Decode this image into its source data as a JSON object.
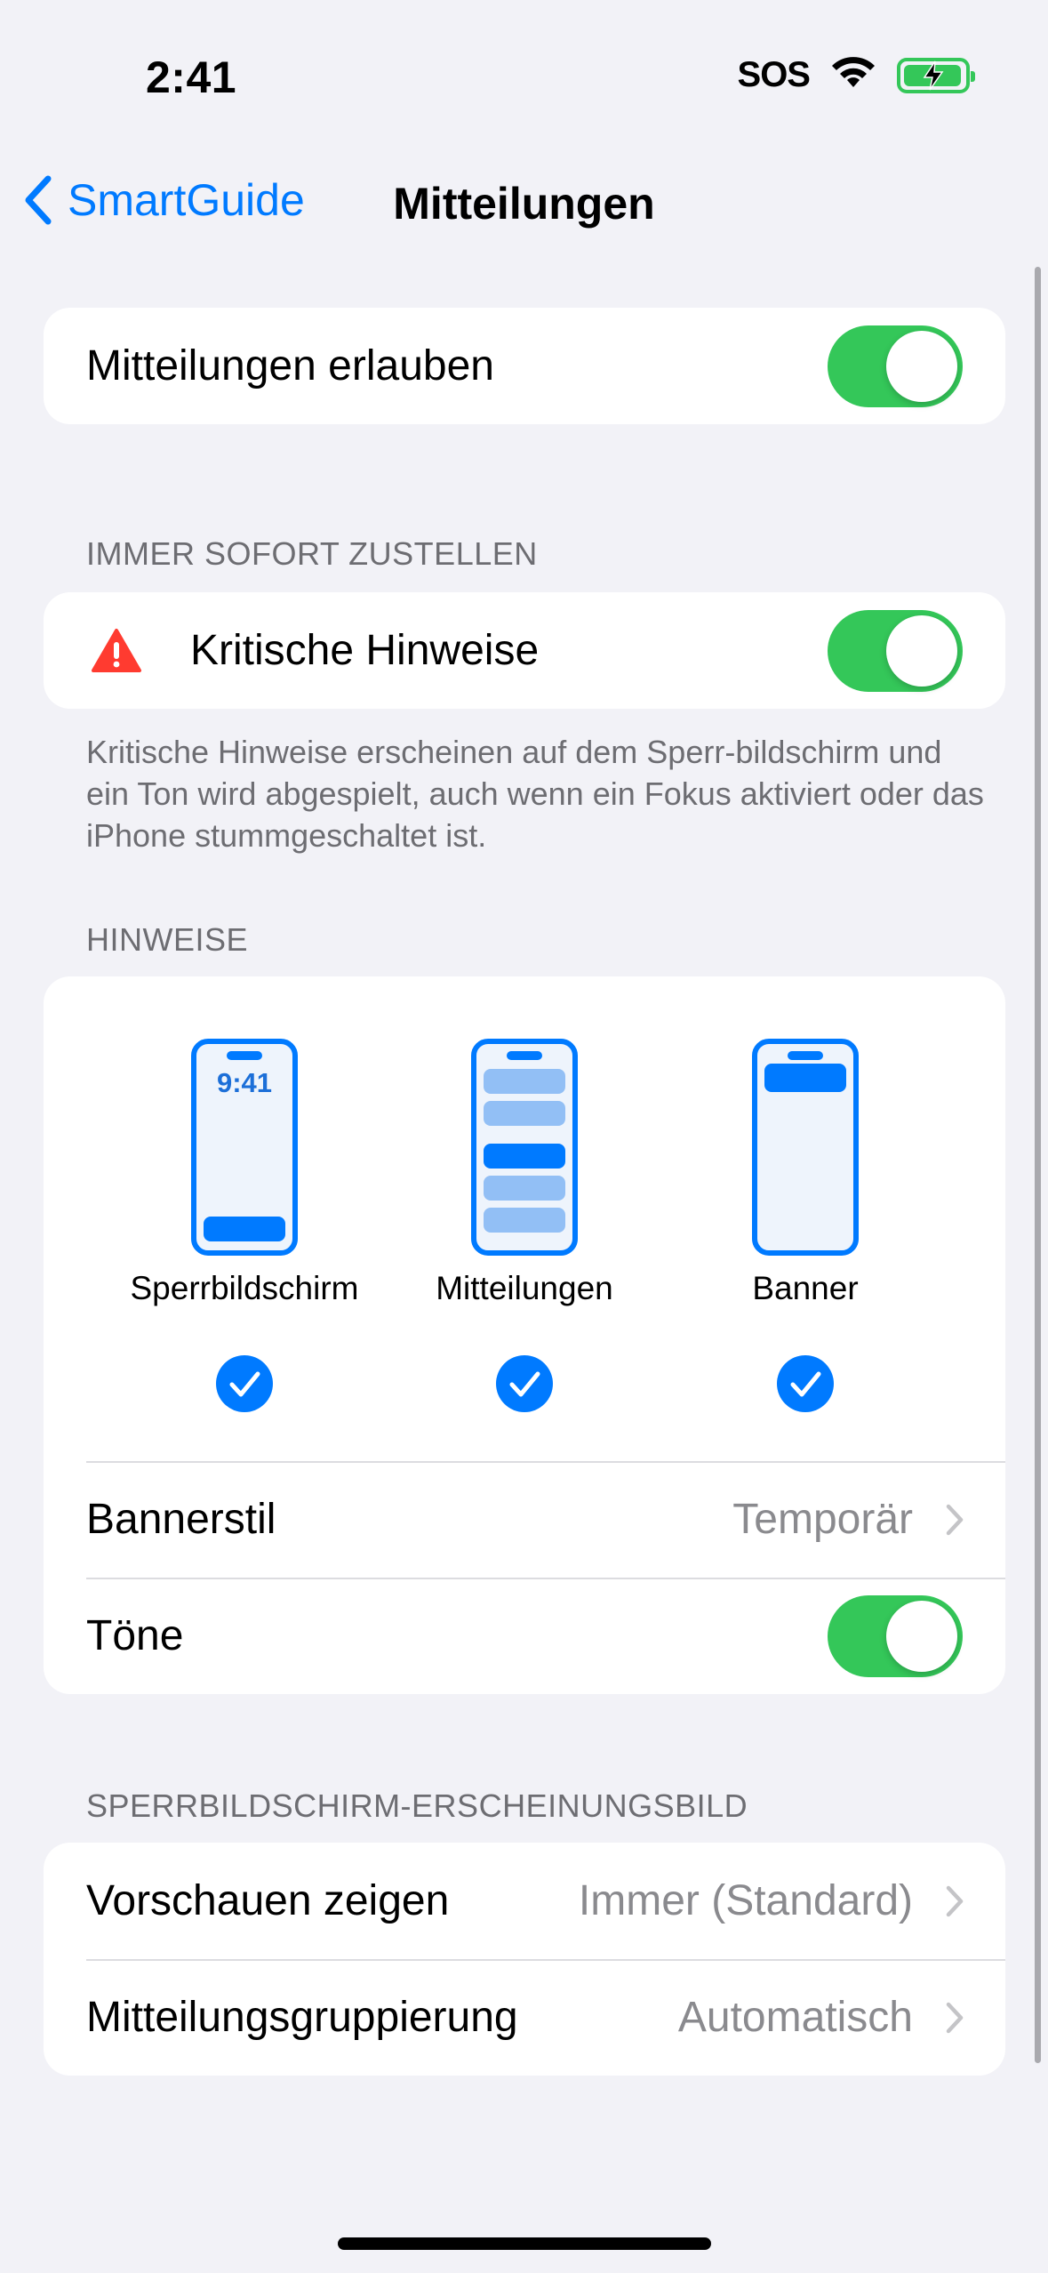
{
  "status_bar": {
    "time": "2:41",
    "sos": "SOS",
    "battery_color": "#34c759"
  },
  "nav": {
    "back_label": "SmartGuide",
    "title": "Mitteilungen",
    "accent": "#007aff"
  },
  "allow": {
    "label": "Mitteilungen erlauben",
    "enabled": true
  },
  "immediate": {
    "header": "IMMER SOFORT ZUSTELLEN",
    "critical_label": "Kritische Hinweise",
    "critical_enabled": true,
    "icon": "warning-triangle-icon",
    "footnote": "Kritische Hinweise erscheinen auf dem Sperr-bildschirm und ein Ton wird abgespielt, auch wenn ein Fokus aktiviert oder das iPhone stummgeschaltet ist."
  },
  "alerts": {
    "header": "HINWEISE",
    "styles": [
      {
        "label": "Sperrbildschirm",
        "preview_time": "9:41",
        "checked": true
      },
      {
        "label": "Mitteilungen",
        "checked": true
      },
      {
        "label": "Banner",
        "checked": true
      }
    ],
    "banner_style_label": "Bannerstil",
    "banner_style_value": "Temporär",
    "sounds_label": "Töne",
    "sounds_enabled": true
  },
  "lockscreen": {
    "header": "SPERRBILDSCHIRM-ERSCHEINUNGSBILD",
    "previews_label": "Vorschauen zeigen",
    "previews_value": "Immer (Standard)",
    "grouping_label": "Mitteilungsgruppierung",
    "grouping_value": "Automatisch"
  },
  "toggle_on_color": "#34c759"
}
